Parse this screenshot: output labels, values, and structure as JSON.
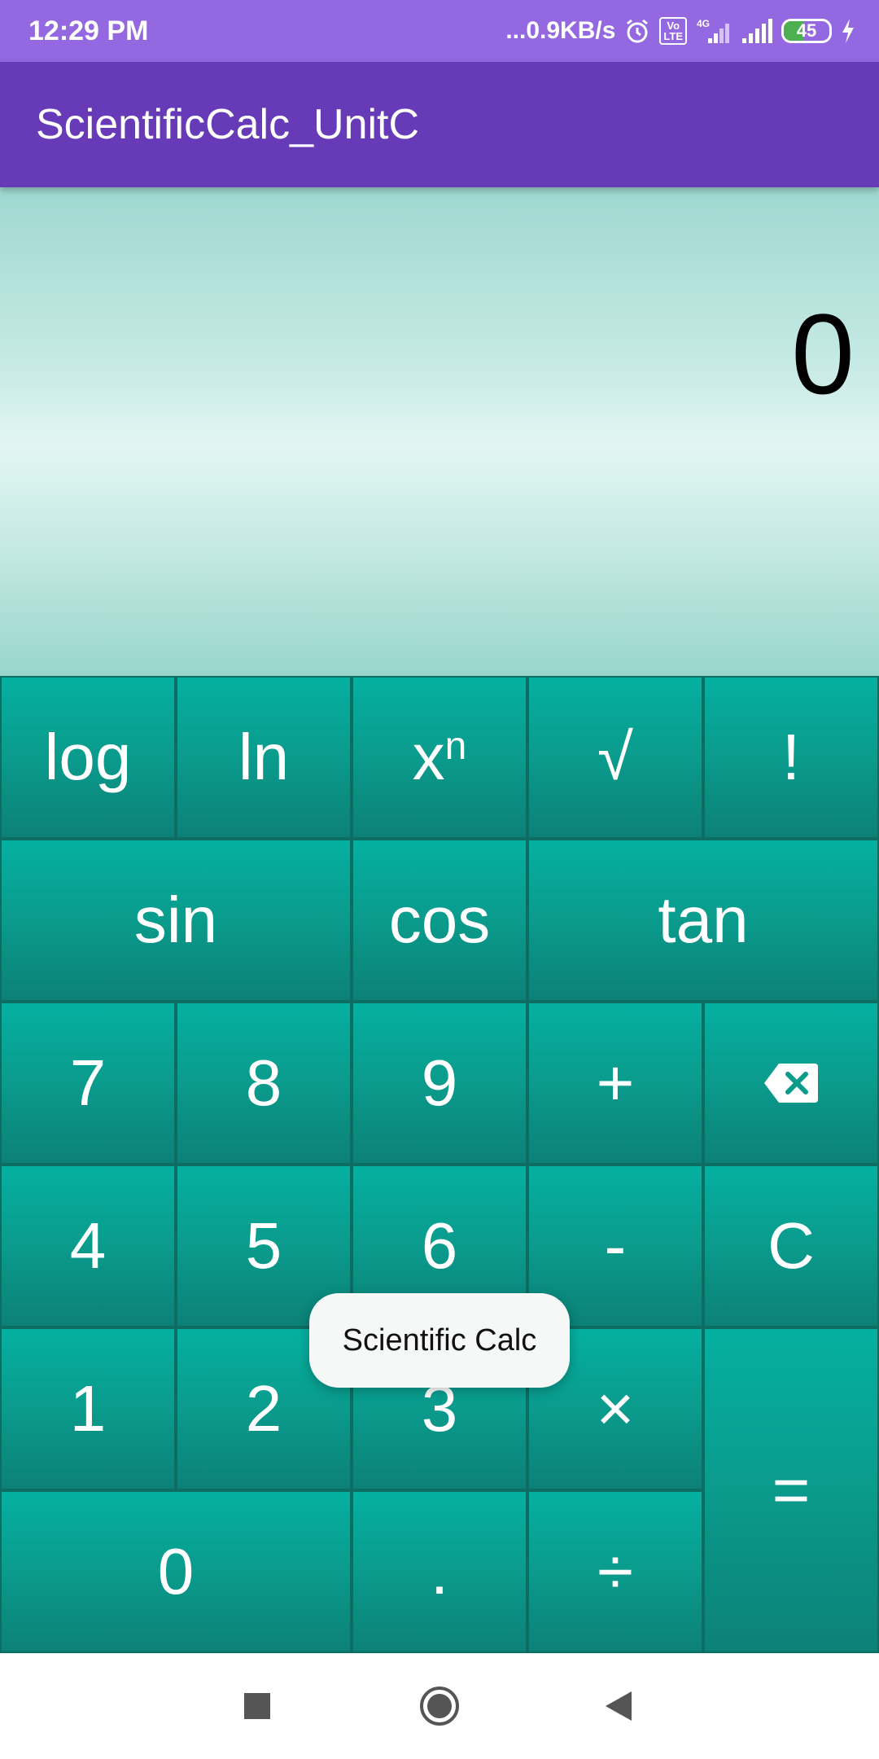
{
  "status_bar": {
    "time": "12:29 PM",
    "network_speed": "...0.9KB/s",
    "icons": [
      "alarm-icon",
      "volte-icon",
      "signal-4g-icon",
      "signal-icon",
      "battery-icon",
      "charging-icon"
    ],
    "volte_label": "Vo\nLTE",
    "network_type": "4G",
    "battery_percent": "45",
    "battery_level": 0.45
  },
  "app_bar": {
    "title": "ScientificCalc_UnitC",
    "color": "#673ab7"
  },
  "display": {
    "value": "0"
  },
  "keypad": {
    "log": "log",
    "ln": "ln",
    "pow_base": "x",
    "pow_exp": "n",
    "sqrt": "√",
    "fact": "!",
    "sin": "sin",
    "cos": "cos",
    "tan": "tan",
    "seven": "7",
    "eight": "8",
    "nine": "9",
    "plus": "+",
    "four": "4",
    "five": "5",
    "six": "6",
    "minus": "-",
    "clear": "C",
    "one": "1",
    "two": "2",
    "three": "3",
    "multiply": "×",
    "equals": "=",
    "zero": "0",
    "dot": ".",
    "divide": "÷",
    "backspace_icon": "backspace-icon",
    "accent": "#0a9b8c"
  },
  "toast": {
    "text": "Scientific Calc"
  },
  "nav_bar": {
    "icons": [
      "recents-square-icon",
      "home-circle-icon",
      "back-triangle-icon"
    ]
  }
}
